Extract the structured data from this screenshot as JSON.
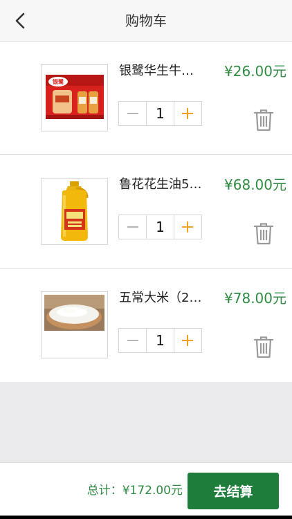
{
  "nav": {
    "title": "购物车",
    "back_icon": "chevron-left-icon"
  },
  "items": [
    {
      "name": "银鹭华生牛…",
      "price": "¥26.00元",
      "quantity": "1",
      "image": "peanut-milk-gift-box"
    },
    {
      "name": "鲁花花生油5…",
      "price": "¥68.00元",
      "quantity": "1",
      "image": "peanut-oil-bottle"
    },
    {
      "name": "五常大米（2…",
      "price": "¥78.00元",
      "quantity": "1",
      "image": "rice-bowl"
    }
  ],
  "footer": {
    "total_label": "总计：",
    "total_value": "¥172.00元",
    "checkout_label": "去结算"
  },
  "colors": {
    "price": "#2e8b41",
    "checkout_bg": "#1f7d3c",
    "stepper_accent": "#f0a020",
    "stepper_muted": "#b5b5b5",
    "trash": "#9a9a9a"
  }
}
